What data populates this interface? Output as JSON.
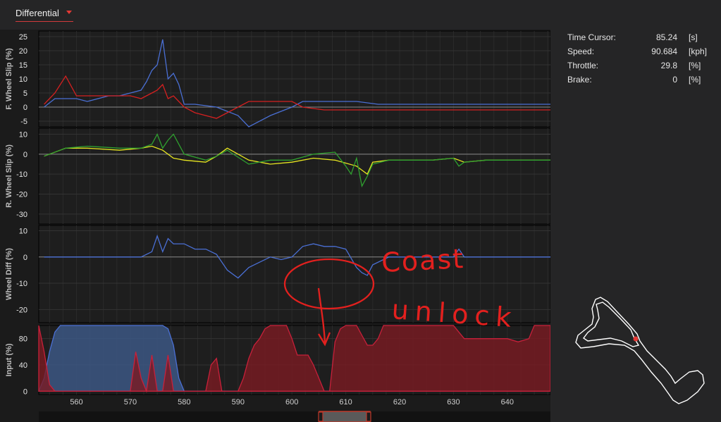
{
  "header": {
    "view_selector": "Differential"
  },
  "info": [
    {
      "label": "Time Cursor:",
      "value": "85.24",
      "unit": "[s]"
    },
    {
      "label": "Speed:",
      "value": "90.684",
      "unit": "[kph]"
    },
    {
      "label": "Throttle:",
      "value": "29.8",
      "unit": "[%]"
    },
    {
      "label": "Brake:",
      "value": "0",
      "unit": "[%]"
    }
  ],
  "annotation": {
    "circled_text": [
      "Coast",
      "unlock"
    ]
  },
  "chart_data": [
    {
      "type": "line",
      "ylabel": "F. Wheel Slip (%)",
      "yticks": [
        25,
        20,
        15,
        10,
        5,
        0,
        -5
      ],
      "ylim": [
        -7,
        27
      ],
      "xlim": [
        553,
        648
      ],
      "series": [
        {
          "color": "#4a6fd4",
          "x": [
            554,
            556,
            558,
            560,
            562,
            566,
            568,
            570,
            572,
            573,
            574,
            575,
            576,
            577,
            578,
            579,
            580,
            582,
            586,
            590,
            592,
            596,
            600,
            602,
            606,
            612,
            616,
            620,
            630,
            640,
            648
          ],
          "y": [
            0,
            3,
            3,
            3,
            2,
            4,
            4,
            5,
            6,
            9,
            13,
            15,
            24,
            10,
            12,
            8,
            1,
            1,
            0,
            -3,
            -7,
            -3,
            0,
            2,
            2,
            2,
            1,
            1,
            1,
            1,
            1
          ]
        },
        {
          "color": "#d42020",
          "x": [
            554,
            556,
            558,
            560,
            562,
            566,
            568,
            570,
            572,
            573,
            574,
            575,
            576,
            577,
            578,
            579,
            580,
            582,
            586,
            590,
            592,
            596,
            600,
            602,
            606,
            612,
            616,
            620,
            630,
            640,
            648
          ],
          "y": [
            1,
            5,
            11,
            4,
            4,
            4,
            4,
            4,
            3,
            4,
            5,
            6,
            8,
            3,
            4,
            2,
            0,
            -2,
            -4,
            0,
            2,
            2,
            2,
            0,
            -1,
            -1,
            -1,
            -1,
            -1,
            -1,
            -1
          ]
        }
      ]
    },
    {
      "type": "line",
      "ylabel": "R. Wheel Slip (%)",
      "yticks": [
        10,
        0,
        -10,
        -20,
        -30
      ],
      "ylim": [
        -35,
        13
      ],
      "xlim": [
        553,
        648
      ],
      "series": [
        {
          "color": "#e8e620",
          "x": [
            554,
            558,
            562,
            568,
            572,
            574,
            576,
            578,
            580,
            584,
            586,
            588,
            592,
            596,
            600,
            604,
            608,
            612,
            613,
            614,
            615,
            618,
            626,
            630,
            631,
            632,
            636,
            640,
            648
          ],
          "y": [
            -1,
            3,
            3,
            2,
            3,
            4,
            2,
            -2,
            -3,
            -4,
            -1,
            3,
            -3,
            -5,
            -4,
            -2,
            -3,
            -6,
            -8,
            -10,
            -4,
            -3,
            -3,
            -2,
            -3,
            -4,
            -3,
            -3,
            -3
          ]
        },
        {
          "color": "#2fa02f",
          "x": [
            554,
            558,
            562,
            568,
            572,
            574,
            575,
            576,
            577,
            578,
            580,
            584,
            586,
            588,
            592,
            596,
            600,
            604,
            608,
            610,
            611,
            612,
            613,
            614,
            615,
            618,
            626,
            630,
            631,
            632,
            636,
            640,
            648
          ],
          "y": [
            -1,
            3,
            4,
            3,
            3,
            5,
            10,
            3,
            7,
            10,
            0,
            -3,
            -1,
            2,
            -5,
            -3,
            -3,
            0,
            1,
            -6,
            -10,
            -2,
            -16,
            -11,
            -5,
            -3,
            -3,
            -2,
            -6,
            -4,
            -3,
            -3,
            -3
          ]
        }
      ]
    },
    {
      "type": "line",
      "ylabel": "Wheel Diff (%)",
      "yticks": [
        10,
        0,
        -10,
        -20
      ],
      "ylim": [
        -25,
        12
      ],
      "xlim": [
        553,
        648
      ],
      "series": [
        {
          "color": "#4a6fd4",
          "x": [
            554,
            560,
            570,
            572,
            574,
            575,
            576,
            577,
            578,
            580,
            582,
            584,
            586,
            588,
            590,
            592,
            594,
            596,
            598,
            600,
            602,
            604,
            606,
            608,
            610,
            612,
            613,
            614,
            615,
            618,
            626,
            630,
            631,
            632,
            636,
            640,
            648
          ],
          "y": [
            0,
            0,
            0,
            0,
            2,
            8,
            2,
            7,
            5,
            5,
            3,
            3,
            1,
            -5,
            -8,
            -4,
            -2,
            0,
            -1,
            0,
            4,
            5,
            4,
            4,
            3,
            -4,
            -6,
            -7,
            -3,
            0,
            0,
            0,
            3,
            0,
            0,
            0,
            0
          ]
        }
      ]
    },
    {
      "type": "area",
      "ylabel": "Input (%)",
      "yticks": [
        80,
        40,
        0
      ],
      "ylim": [
        -5,
        100
      ],
      "xlim": [
        553,
        648
      ],
      "xticks": [
        560,
        570,
        580,
        590,
        600,
        610,
        620,
        630,
        640
      ],
      "series": [
        {
          "name": "",
          "color": "#4a6fd4",
          "fill": "#3d5a8a",
          "x": [
            553,
            554,
            555,
            556,
            557,
            558,
            576,
            577,
            578,
            579,
            580,
            581,
            648
          ],
          "y": [
            0,
            20,
            60,
            90,
            100,
            100,
            100,
            95,
            70,
            20,
            0,
            0,
            0
          ]
        },
        {
          "name": "",
          "color": "#c8203a",
          "fill": "#7a1a22",
          "x": [
            553,
            554,
            555,
            556,
            570,
            571,
            572,
            573,
            574,
            575,
            576,
            577,
            578,
            579,
            584,
            585,
            586,
            587,
            588,
            590,
            591,
            592,
            593,
            594,
            595,
            596,
            597,
            598,
            599,
            600,
            601,
            602,
            603,
            604,
            605,
            606,
            607,
            608,
            609,
            610,
            611,
            612,
            613,
            614,
            615,
            616,
            617,
            620,
            621,
            624,
            625,
            626,
            628,
            630,
            632,
            633,
            634,
            640,
            642,
            644,
            645,
            646,
            648
          ],
          "y": [
            100,
            60,
            10,
            0,
            0,
            60,
            20,
            0,
            55,
            0,
            0,
            55,
            0,
            0,
            0,
            40,
            50,
            0,
            0,
            0,
            20,
            50,
            70,
            80,
            95,
            100,
            100,
            100,
            100,
            80,
            55,
            55,
            55,
            40,
            20,
            0,
            0,
            75,
            95,
            100,
            100,
            100,
            85,
            70,
            70,
            80,
            100,
            100,
            100,
            100,
            100,
            100,
            100,
            100,
            80,
            80,
            80,
            80,
            75,
            80,
            100,
            100,
            100
          ]
        }
      ]
    }
  ],
  "track_map": {
    "cursor_color": "#e53935",
    "line_color": "#ffffff"
  }
}
